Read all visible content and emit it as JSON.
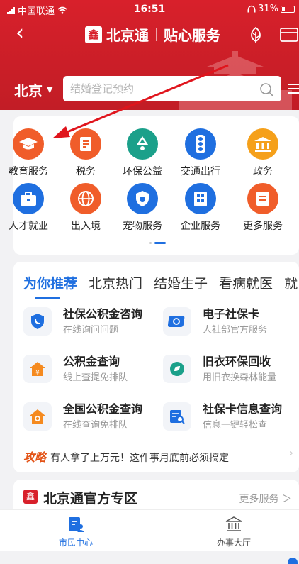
{
  "status_bar": {
    "carrier": "中国联通",
    "time": "16:51",
    "battery": "31%"
  },
  "navbar": {
    "brand": "北京通",
    "brand_logo": "鑫",
    "service": "贴心服务"
  },
  "search": {
    "city": "北京",
    "placeholder": "结婚登记预约"
  },
  "services": [
    {
      "label": "教育服务",
      "icon": "mortarboard-icon",
      "color": "#f05d2a"
    },
    {
      "label": "税务",
      "icon": "tax-icon",
      "color": "#f05d2a"
    },
    {
      "label": "环保公益",
      "icon": "recycle-icon",
      "color": "#1ba08a"
    },
    {
      "label": "交通出行",
      "icon": "traffic-light-icon",
      "color": "#1f6fe0"
    },
    {
      "label": "政务",
      "icon": "government-icon",
      "color": "#f5a01a"
    },
    {
      "label": "人才就业",
      "icon": "briefcase-icon",
      "color": "#1f6fe0"
    },
    {
      "label": "出入境",
      "icon": "globe-icon",
      "color": "#f05d2a"
    },
    {
      "label": "宠物服务",
      "icon": "pet-icon",
      "color": "#1f6fe0"
    },
    {
      "label": "企业服务",
      "icon": "building-icon",
      "color": "#1f6fe0"
    },
    {
      "label": "更多服务",
      "icon": "more-services-icon",
      "color": "#f05d2a"
    }
  ],
  "recommend": {
    "tabs": [
      "为你推荐",
      "北京热门",
      "结婚生子",
      "看病就医",
      "就"
    ],
    "items": [
      {
        "title": "社保公积金咨询",
        "subtitle": "在线询问问题"
      },
      {
        "title": "电子社保卡",
        "subtitle": "人社部官方服务"
      },
      {
        "title": "公积金查询",
        "subtitle": "线上查提免排队"
      },
      {
        "title": "旧衣环保回收",
        "subtitle": "用旧衣换森林能量"
      },
      {
        "title": "全国公积金查询",
        "subtitle": "在线查询免排队"
      },
      {
        "title": "社保卡信息查询",
        "subtitle": "信息一键轻松查"
      }
    ],
    "tip_tag": "攻略",
    "tip_text": "有人拿了上万元！这件事月底前必须搞定"
  },
  "official": {
    "logo": "鑫",
    "title": "北京通官方专区",
    "more": "更多服务 ＞"
  },
  "tabbar": [
    {
      "label": "市民中心",
      "active": true
    },
    {
      "label": "办事大厅",
      "active": false
    }
  ],
  "colors": {
    "brand_red": "#d8202b",
    "accent_blue": "#1f6fe0",
    "tip_orange": "#e35215"
  }
}
